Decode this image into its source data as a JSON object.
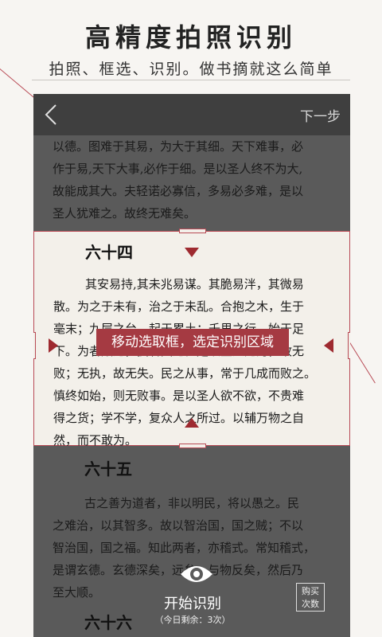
{
  "hero": {
    "title": "高精度拍照识别",
    "subtitle": "拍照、框选、识别。做书摘就这么简单"
  },
  "appbar": {
    "back_icon": "chevron-left-icon",
    "next_label": "下一步"
  },
  "page_text": {
    "top_paragraph": [
      "以德。图难于其易，为大于其细。天下难事，必",
      "作于易,天下大事,必作于细。是以圣人终不为大,",
      "故能成其大。夫轻诺必寡信，多易必多难，是以",
      "圣人犹难之。故终无难矣。"
    ],
    "section_64_heading": "六十四",
    "section_64_paragraph": [
      "其安易持,其未兆易谋。其脆易泮，其微易",
      "散。为之于未有，治之于未乱。合抱之木，生于",
      "毫末；九层之台，起于累土；千里之行，始于足",
      "下。为者败之，执者失之。是以圣人无为，故无",
      "败；无执，故无失。民之从事，常于几成而败之。",
      "慎终如始，则无败事。是以圣人欲不欲，不贵难",
      "得之货；学不学，复众人之所过。以辅万物之自",
      "然，而不敢为。"
    ],
    "section_65_heading": "六十五",
    "section_65_paragraph": [
      "古之善为道者，非以明民，将以愚之。民",
      "之难治，以其智多。故以智治国，国之贼；不以",
      "智治国，国之福。知此两者，亦稽式。常知稽式，",
      "是谓玄德。玄德深矣，远矣，与物反矣，然后乃",
      "至大顺。"
    ],
    "section_66_heading": "六十六"
  },
  "selection": {
    "tooltip": "移动选取框，选定识别区域"
  },
  "bottom": {
    "eye_icon": "eye-icon",
    "start_label": "开始识别",
    "remaining_label": "（今日剩余：3次）",
    "buy_label_line1": "购买",
    "buy_label_line2": "次数"
  },
  "colors": {
    "accent": "#a53a42",
    "frame_border": "#b84a55",
    "app_dark": "#5a5a5a",
    "appbar": "#3f3f3f",
    "paper": "#f3f0ea"
  }
}
